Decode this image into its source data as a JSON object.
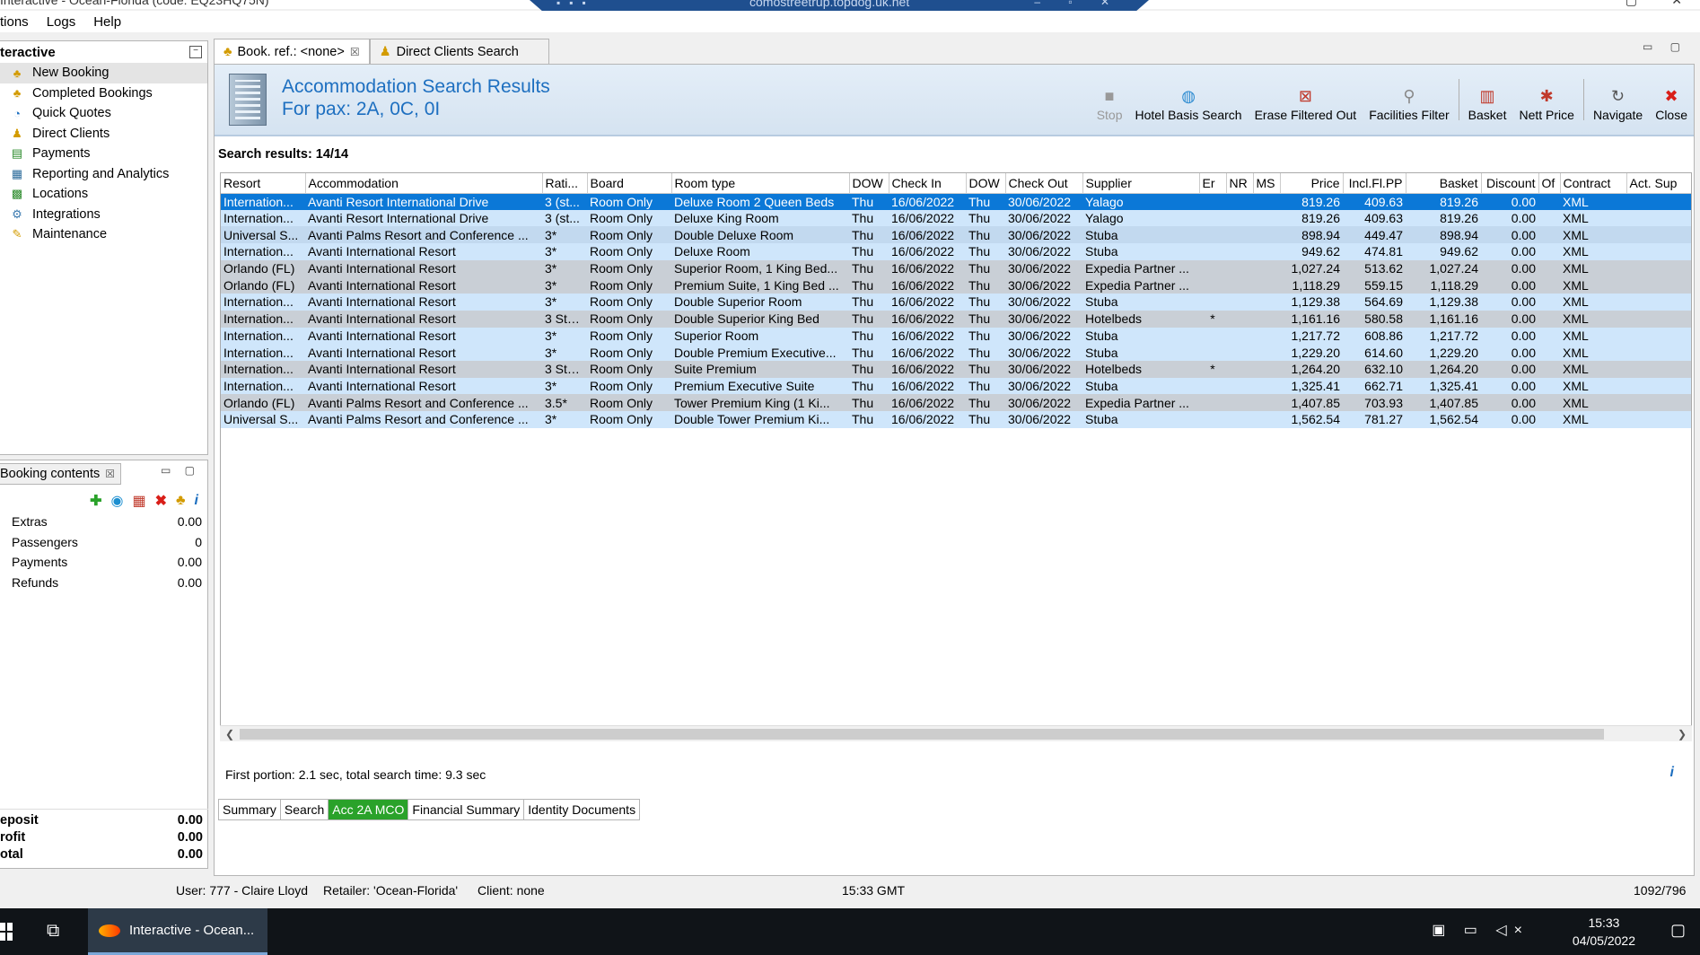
{
  "window": {
    "title": "Interactive - Ocean-Florida (code: EQ23HQ75N)",
    "remote_host": "comostreetrup.topdog.uk.net"
  },
  "menu": [
    "tions",
    "Logs",
    "Help"
  ],
  "left_panel": {
    "title": "teractive",
    "items": [
      {
        "label": "New Booking",
        "icon": "palm-tree-icon",
        "active": true
      },
      {
        "label": "Completed Bookings",
        "icon": "palm-tree-icon"
      },
      {
        "label": "Quick Quotes",
        "icon": "clock-icon"
      },
      {
        "label": "Direct Clients",
        "icon": "person-icon"
      },
      {
        "label": "Payments",
        "icon": "payment-icon"
      },
      {
        "label": "Reporting and Analytics",
        "icon": "report-icon"
      },
      {
        "label": "Locations",
        "icon": "map-icon"
      },
      {
        "label": "Integrations",
        "icon": "integration-icon"
      },
      {
        "label": "Maintenance",
        "icon": "wrench-icon"
      }
    ]
  },
  "booking_contents": {
    "tab_label": "Booking contents",
    "rows": [
      {
        "label": "Extras",
        "value": "0.00"
      },
      {
        "label": "Passengers",
        "value": "0"
      },
      {
        "label": "Payments",
        "value": "0.00"
      },
      {
        "label": "Refunds",
        "value": "0.00"
      }
    ],
    "totals": [
      {
        "label": "eposit",
        "value": "0.00"
      },
      {
        "label": "rofit",
        "value": "0.00"
      },
      {
        "label": "otal",
        "value": "0.00"
      }
    ]
  },
  "tabs": [
    {
      "label": "Book. ref.: <none>",
      "active": true,
      "closable": true
    },
    {
      "label": "Direct Clients Search",
      "active": false
    }
  ],
  "results": {
    "title": "Accommodation Search Results",
    "subtitle": "For pax: 2A, 0C, 0I",
    "count_label": "Search results: 14/14",
    "timing": "First portion: 2.1 sec, total search time: 9.3 sec"
  },
  "toolbar": [
    {
      "label": "Stop",
      "icon": "stop-icon",
      "disabled": true
    },
    {
      "label": "Hotel Basis Search",
      "icon": "globe-search-icon"
    },
    {
      "label": "Erase Filtered Out",
      "icon": "erase-icon"
    },
    {
      "label": "Facilities Filter",
      "icon": "filter-icon"
    },
    {
      "sep": true
    },
    {
      "label": "Basket",
      "icon": "basket-icon"
    },
    {
      "label": "Nett Price",
      "icon": "price-icon"
    },
    {
      "sep": true
    },
    {
      "label": "Navigate",
      "icon": "navigate-icon"
    },
    {
      "label": "Close",
      "icon": "close-icon"
    }
  ],
  "columns": [
    "Resort",
    "Accommodation",
    "Rati...",
    "Board",
    "Room type",
    "DOW",
    "Check In",
    "DOW",
    "Check Out",
    "Supplier",
    "Er",
    "NR",
    "MS",
    "Price",
    "Incl.Fl.PP",
    "Basket",
    "Discount",
    "Of",
    "Contract",
    "Act. Sup"
  ],
  "rows": [
    [
      "Internation...",
      "Avanti Resort International Drive",
      "3 (st...",
      "Room Only",
      "Deluxe Room 2 Queen Beds",
      "Thu",
      "16/06/2022",
      "Thu",
      "30/06/2022",
      "Yalago",
      "",
      "",
      "",
      "819.26",
      "409.63",
      "819.26",
      "0.00",
      "",
      "XML",
      ""
    ],
    [
      "Internation...",
      "Avanti Resort International Drive",
      "3 (st...",
      "Room Only",
      "Deluxe King Room",
      "Thu",
      "16/06/2022",
      "Thu",
      "30/06/2022",
      "Yalago",
      "",
      "",
      "",
      "819.26",
      "409.63",
      "819.26",
      "0.00",
      "",
      "XML",
      ""
    ],
    [
      "Universal S...",
      "Avanti Palms Resort and Conference ...",
      "3*",
      "Room Only",
      "Double Deluxe Room",
      "Thu",
      "16/06/2022",
      "Thu",
      "30/06/2022",
      "Stuba",
      "",
      "",
      "",
      "898.94",
      "449.47",
      "898.94",
      "0.00",
      "",
      "XML",
      ""
    ],
    [
      "Internation...",
      "Avanti International Resort",
      "3*",
      "Room Only",
      "Deluxe Room",
      "Thu",
      "16/06/2022",
      "Thu",
      "30/06/2022",
      "Stuba",
      "",
      "",
      "",
      "949.62",
      "474.81",
      "949.62",
      "0.00",
      "",
      "XML",
      ""
    ],
    [
      "Orlando (FL)",
      "Avanti International Resort",
      "3*",
      "Room Only",
      "Superior Room, 1 King Bed...",
      "Thu",
      "16/06/2022",
      "Thu",
      "30/06/2022",
      "Expedia Partner ...",
      "",
      "",
      "",
      "1,027.24",
      "513.62",
      "1,027.24",
      "0.00",
      "",
      "XML",
      ""
    ],
    [
      "Orlando (FL)",
      "Avanti International Resort",
      "3*",
      "Room Only",
      "Premium Suite, 1 King Bed ...",
      "Thu",
      "16/06/2022",
      "Thu",
      "30/06/2022",
      "Expedia Partner ...",
      "",
      "",
      "",
      "1,118.29",
      "559.15",
      "1,118.29",
      "0.00",
      "",
      "XML",
      ""
    ],
    [
      "Internation...",
      "Avanti International Resort",
      "3*",
      "Room Only",
      "Double Superior Room",
      "Thu",
      "16/06/2022",
      "Thu",
      "30/06/2022",
      "Stuba",
      "",
      "",
      "",
      "1,129.38",
      "564.69",
      "1,129.38",
      "0.00",
      "",
      "XML",
      ""
    ],
    [
      "Internation...",
      "Avanti International Resort",
      "3 Sta...",
      "Room Only",
      "Double Superior King Bed",
      "Thu",
      "16/06/2022",
      "Thu",
      "30/06/2022",
      "Hotelbeds",
      "*",
      "",
      "",
      "1,161.16",
      "580.58",
      "1,161.16",
      "0.00",
      "",
      "XML",
      ""
    ],
    [
      "Internation...",
      "Avanti International Resort",
      "3*",
      "Room Only",
      "Superior Room",
      "Thu",
      "16/06/2022",
      "Thu",
      "30/06/2022",
      "Stuba",
      "",
      "",
      "",
      "1,217.72",
      "608.86",
      "1,217.72",
      "0.00",
      "",
      "XML",
      ""
    ],
    [
      "Internation...",
      "Avanti International Resort",
      "3*",
      "Room Only",
      "Double Premium Executive...",
      "Thu",
      "16/06/2022",
      "Thu",
      "30/06/2022",
      "Stuba",
      "",
      "",
      "",
      "1,229.20",
      "614.60",
      "1,229.20",
      "0.00",
      "",
      "XML",
      ""
    ],
    [
      "Internation...",
      "Avanti International Resort",
      "3 Sta...",
      "Room Only",
      "Suite Premium",
      "Thu",
      "16/06/2022",
      "Thu",
      "30/06/2022",
      "Hotelbeds",
      "*",
      "",
      "",
      "1,264.20",
      "632.10",
      "1,264.20",
      "0.00",
      "",
      "XML",
      ""
    ],
    [
      "Internation...",
      "Avanti International Resort",
      "3*",
      "Room Only",
      "Premium Executive Suite",
      "Thu",
      "16/06/2022",
      "Thu",
      "30/06/2022",
      "Stuba",
      "",
      "",
      "",
      "1,325.41",
      "662.71",
      "1,325.41",
      "0.00",
      "",
      "XML",
      ""
    ],
    [
      "Orlando (FL)",
      "Avanti Palms Resort and Conference ...",
      "3.5*",
      "Room Only",
      "Tower Premium King (1 Ki...",
      "Thu",
      "16/06/2022",
      "Thu",
      "30/06/2022",
      "Expedia Partner ...",
      "",
      "",
      "",
      "1,407.85",
      "703.93",
      "1,407.85",
      "0.00",
      "",
      "XML",
      ""
    ],
    [
      "Universal S...",
      "Avanti Palms Resort and Conference ...",
      "3*",
      "Room Only",
      "Double Tower Premium Ki...",
      "Thu",
      "16/06/2022",
      "Thu",
      "30/06/2022",
      "Stuba",
      "",
      "",
      "",
      "1,562.54",
      "781.27",
      "1,562.54",
      "0.00",
      "",
      "XML",
      ""
    ]
  ],
  "row_styles": [
    "selected",
    "even",
    "odd",
    "even",
    "grey",
    "grey",
    "even",
    "grey",
    "even",
    "even",
    "grey",
    "even",
    "grey",
    "even"
  ],
  "bottom_tabs": [
    {
      "label": "Summary"
    },
    {
      "label": "Search"
    },
    {
      "label": "Acc 2A MCO",
      "highlight": true
    },
    {
      "label": "Financial Summary"
    },
    {
      "label": "Identity Documents"
    }
  ],
  "status": {
    "user": "User: 777 - Claire Lloyd",
    "retailer": "Retailer: 'Ocean-Florida'",
    "client": "Client: none",
    "time": "15:33 GMT",
    "memory": "1092/796"
  },
  "taskbar": {
    "app_label": "Interactive - Ocean...",
    "time": "15:33",
    "date": "04/05/2022"
  },
  "colors": {
    "accent": "#1d6fc0",
    "selected_row": "#0b78d7",
    "row_blue": "#cfe6fb",
    "row_grey": "#c9cfd6",
    "highlight_tab": "#2aa22a"
  }
}
